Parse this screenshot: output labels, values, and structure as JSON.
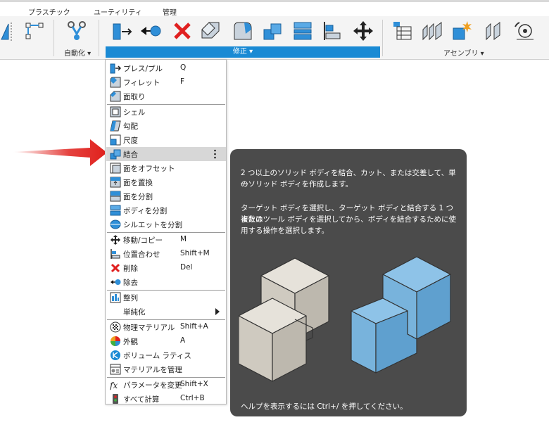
{
  "top_tabs": [
    "プラスチック",
    "ユーティリティ",
    "管理"
  ],
  "groups": {
    "automate": "自動化 ▾",
    "modify": "修正 ▾",
    "assemble": "アセンブリ ▾"
  },
  "menu_items": [
    {
      "label": "プレス/プル",
      "shortcut": "Q",
      "icon": "press-pull-icon"
    },
    {
      "label": "フィレット",
      "shortcut": "F",
      "icon": "fillet-icon"
    },
    {
      "label": "面取り",
      "shortcut": "",
      "icon": "chamfer-icon"
    },
    {
      "label": "シェル",
      "shortcut": "",
      "icon": "shell-icon"
    },
    {
      "label": "勾配",
      "shortcut": "",
      "icon": "draft-icon"
    },
    {
      "label": "尺度",
      "shortcut": "",
      "icon": "scale-icon"
    },
    {
      "label": "結合",
      "shortcut": "",
      "icon": "combine-icon"
    },
    {
      "label": "面をオフセット",
      "shortcut": "",
      "icon": "offset-face-icon"
    },
    {
      "label": "面を置換",
      "shortcut": "",
      "icon": "replace-face-icon"
    },
    {
      "label": "面を分割",
      "shortcut": "",
      "icon": "split-face-icon"
    },
    {
      "label": "ボディを分割",
      "shortcut": "",
      "icon": "split-body-icon"
    },
    {
      "label": "シルエットを分割",
      "shortcut": "",
      "icon": "silhouette-split-icon"
    },
    {
      "label": "移動/コピー",
      "shortcut": "M",
      "icon": "move-icon"
    },
    {
      "label": "位置合わせ",
      "shortcut": "Shift+M",
      "icon": "align-icon"
    },
    {
      "label": "削除",
      "shortcut": "Del",
      "icon": "delete-icon"
    },
    {
      "label": "除去",
      "shortcut": "",
      "icon": "remove-icon"
    },
    {
      "label": "整列",
      "shortcut": "",
      "icon": "arrange-icon"
    },
    {
      "label": "単純化",
      "shortcut": "",
      "icon": "simplify-icon"
    },
    {
      "label": "物理マテリアル",
      "shortcut": "Shift+A",
      "icon": "physical-material-icon"
    },
    {
      "label": "外観",
      "shortcut": "A",
      "icon": "appearance-icon"
    },
    {
      "label": "ボリューム ラティス",
      "shortcut": "",
      "icon": "volumetric-lattice-icon"
    },
    {
      "label": "マテリアルを管理",
      "shortcut": "",
      "icon": "manage-materials-icon"
    },
    {
      "label": "パラメータを変更",
      "shortcut": "Shift+X",
      "icon": "change-parameters-icon"
    },
    {
      "label": "すべて計算",
      "shortcut": "Ctrl+B",
      "icon": "compute-all-icon"
    }
  ],
  "tooltip": {
    "para1_line1": "2 つ以上のソリッド ボディを結合、カット、または交差して、単一",
    "para1_line2": "のソリッド ボディを作成します。",
    "para2_line1": "ターゲット ボディを選択し、ターゲット ボディと結合する 1 つまたは",
    "para2_line2": "複数のツール ボディを選択してから、ボディを結合するために使",
    "para2_line3": "用する操作を選択します。",
    "footer": "ヘルプを表示するには Ctrl+/ を押してください。"
  },
  "colors": {
    "accent": "#1a8ad4",
    "tooltip_bg": "#4b4b4b",
    "highlight": "#d7d7d7",
    "arrow": "#e0201c"
  }
}
